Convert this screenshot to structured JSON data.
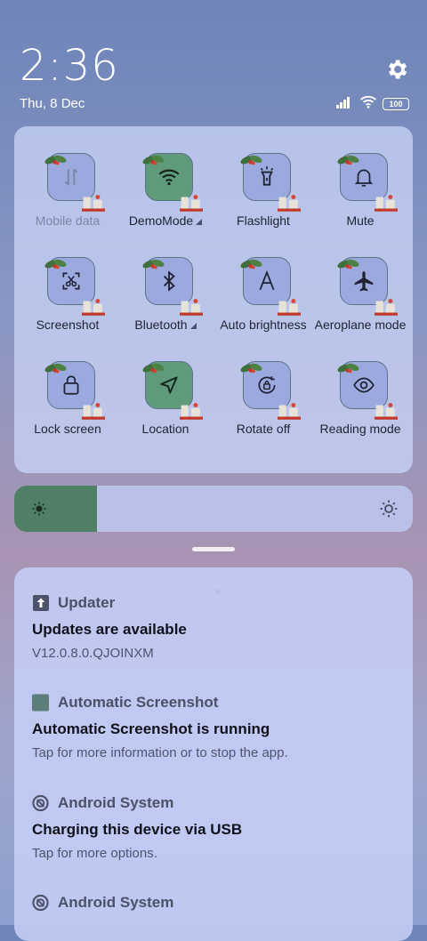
{
  "status": {
    "time": "2:36",
    "date": "Thu, 8 Dec",
    "battery": "100"
  },
  "quick_settings": {
    "tiles": [
      {
        "label": "Mobile data",
        "icon": "mobile-data-icon",
        "active": false,
        "dim": true
      },
      {
        "label": "DemoMode",
        "icon": "wifi-icon",
        "active": true,
        "expand": true
      },
      {
        "label": "Flashlight",
        "icon": "flashlight-icon",
        "active": false
      },
      {
        "label": "Mute",
        "icon": "bell-icon",
        "active": false
      },
      {
        "label": "Screenshot",
        "icon": "screenshot-icon",
        "active": false
      },
      {
        "label": "Bluetooth",
        "icon": "bluetooth-icon",
        "active": false,
        "expand": true
      },
      {
        "label": "Auto brightness",
        "icon": "auto-brightness-icon",
        "active": false
      },
      {
        "label": "Aeroplane mode",
        "icon": "airplane-icon",
        "active": false
      },
      {
        "label": "Lock screen",
        "icon": "lock-icon",
        "active": false
      },
      {
        "label": "Location",
        "icon": "location-icon",
        "active": true
      },
      {
        "label": "Rotate off",
        "icon": "rotate-lock-icon",
        "active": false
      },
      {
        "label": "Reading mode",
        "icon": "eye-icon",
        "active": false
      }
    ],
    "page_count": 2,
    "current_page": 1
  },
  "brightness": {
    "level": 0.208
  },
  "notifications": [
    {
      "app": "Updater",
      "icon": "upload-arrow-icon",
      "title": "Updates are available",
      "body": "V12.0.8.0.QJOINXM"
    },
    {
      "app": "Automatic Screenshot",
      "icon": "app-square-icon",
      "title": "Automatic Screenshot is running",
      "body": "Tap for more information or to stop the app."
    },
    {
      "app": "Android System",
      "icon": "android-system-icon",
      "title": "Charging this device via USB",
      "body": "Tap for more options."
    },
    {
      "app": "Android System",
      "icon": "android-system-icon",
      "title": "",
      "body": ""
    }
  ],
  "colors": {
    "tile_active": "#5f9a7a",
    "tile_inactive": "#9ba9de",
    "brightness_fill": "#4f7f64"
  }
}
